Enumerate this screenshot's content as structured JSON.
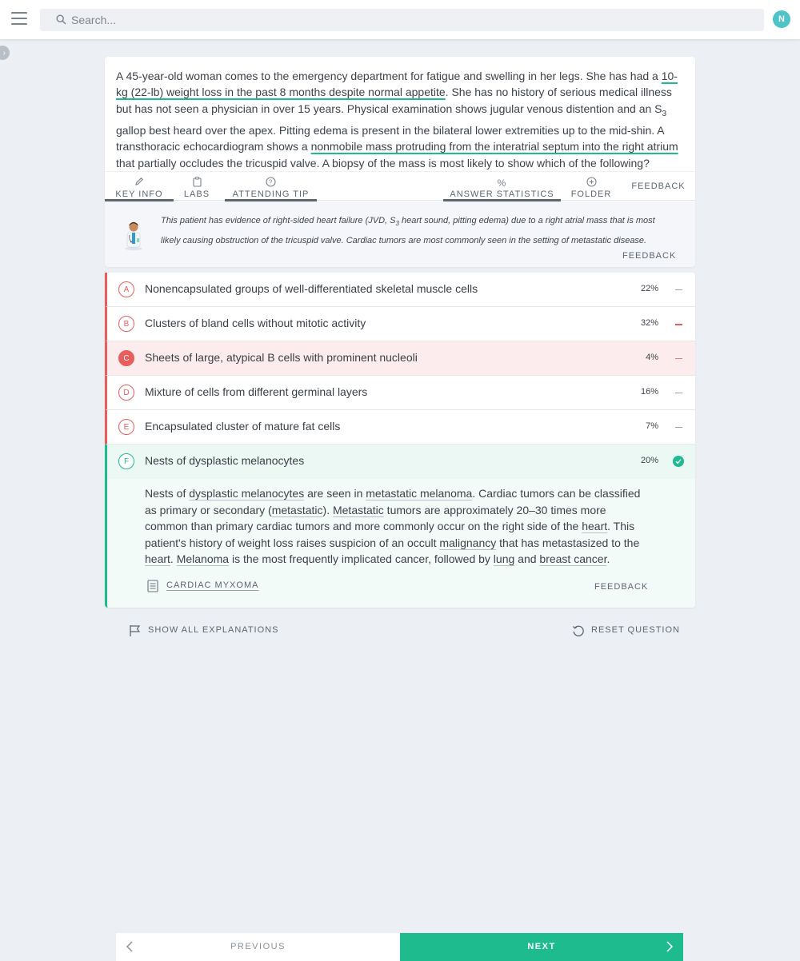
{
  "header": {
    "search_placeholder": "Search...",
    "avatar_initial": "N"
  },
  "question": {
    "stem_parts": [
      "A 45-year-old woman comes to the emergency department for fatigue and swelling in her legs. She has had a ",
      "10-kg (22-lb) weight loss in the past 8 months despite normal appetite",
      ". She has no history of serious medical illness but has not seen a physician in over 15 years. Physical examination shows jugular venous distention and an S",
      "3",
      " gallop best heard over the apex. Pitting edema is present in the bilateral lower extremities up to the mid-shin. A transthoracic echocardiogram shows a ",
      "nonmobile mass protruding from the interatrial septum into the right atrium",
      " that partially occludes the tricuspid valve. A biopsy of the mass is most likely to show which of the following?"
    ]
  },
  "toolbar": {
    "key_info": "KEY INFO",
    "labs": "LABS",
    "attending_tip": "ATTENDING TIP",
    "answer_statistics": "ANSWER STATISTICS",
    "folder": "FOLDER",
    "feedback": "FEEDBACK"
  },
  "tip": {
    "text_a": "This patient has evidence of right-sided heart failure (JVD, S",
    "text_sub": "3",
    "text_b": " heart sound, pitting edema) due to a right atrial mass that is most likely causing obstruction of the tricuspid valve. Cardiac tumors are most commonly seen in the setting of metastatic disease.",
    "feedback": "FEEDBACK"
  },
  "answers": [
    {
      "letter": "A",
      "text": "Nonencapsulated groups of well-differentiated skeletal muscle cells",
      "pct": "22%"
    },
    {
      "letter": "B",
      "text": "Clusters of bland cells without mitotic activity",
      "pct": "32%"
    },
    {
      "letter": "C",
      "text": "Sheets of large, atypical B cells with prominent nucleoli",
      "pct": "4%"
    },
    {
      "letter": "D",
      "text": "Mixture of cells from different germinal layers",
      "pct": "16%"
    },
    {
      "letter": "E",
      "text": "Encapsulated cluster of mature fat cells",
      "pct": "7%"
    },
    {
      "letter": "F",
      "text": "Nests of dysplastic melanocytes",
      "pct": "20%"
    }
  ],
  "explanation": {
    "parts": [
      "Nests of ",
      "dysplastic melanocytes",
      " are seen in ",
      "metastatic melanoma",
      ". Cardiac tumors can be classified as primary or secondary (",
      "metastatic",
      "). ",
      "Metastatic",
      " tumors are approximately 20–30 times more common than primary cardiac tumors and more commonly occur on the right side of the ",
      "heart",
      ". This patient's history of weight loss raises suspicion of an occult ",
      "malignancy",
      " that has metastasized to the ",
      "heart",
      ". ",
      "Melanoma",
      " is the most frequently implicated cancer, followed by ",
      "lung",
      " and ",
      "breast cancer",
      "."
    ],
    "article_link": "CARDIAC MYXOMA",
    "feedback": "FEEDBACK"
  },
  "actions": {
    "show_all": "SHOW ALL EXPLANATIONS",
    "reset": "RESET QUESTION"
  },
  "nav": {
    "previous": "PREVIOUS",
    "next": "NEXT"
  },
  "colors": {
    "accent_green": "#1dbb8e",
    "wrong_red": "#e95d5d",
    "avatar_teal": "#4ec3c9"
  }
}
